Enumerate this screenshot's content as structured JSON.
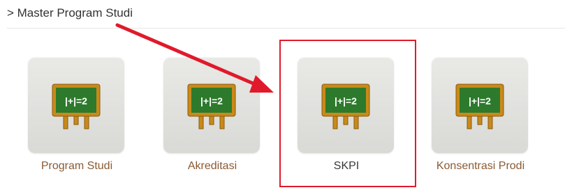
{
  "breadcrumb": {
    "text": "> Master Program Studi"
  },
  "menu": {
    "items": [
      {
        "label": "Program Studi",
        "icon": "chalkboard-icon",
        "highlighted": false
      },
      {
        "label": "Akreditasi",
        "icon": "chalkboard-icon",
        "highlighted": false
      },
      {
        "label": "SKPI",
        "icon": "chalkboard-icon",
        "highlighted": true
      },
      {
        "label": "Konsentrasi Prodi",
        "icon": "chalkboard-icon",
        "highlighted": false
      }
    ],
    "icon_text": "|+|=2"
  },
  "colors": {
    "label": "#8a5a33",
    "highlight": "#e01a2b",
    "board_green": "#2d7a2c",
    "board_frame": "#c98a1a"
  }
}
